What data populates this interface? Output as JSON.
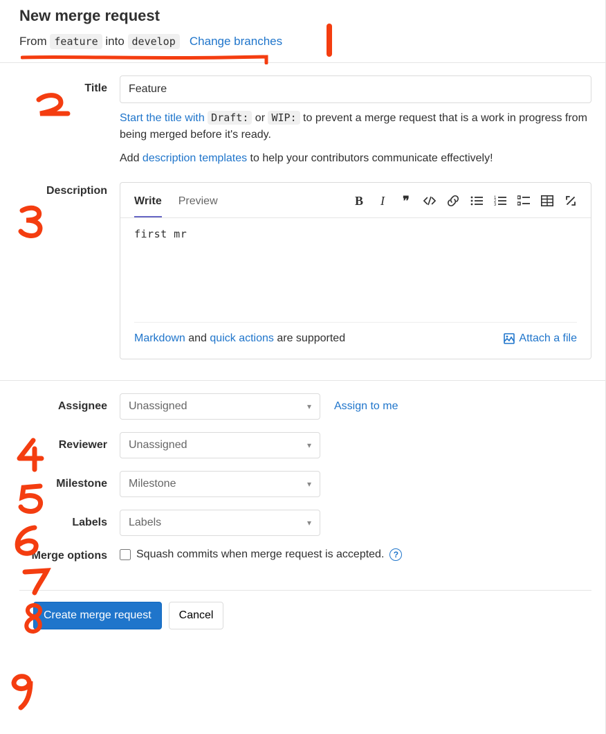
{
  "header": {
    "title": "New merge request",
    "from_label": "From",
    "source_branch": "feature",
    "into_label": "into",
    "target_branch": "develop",
    "change_branches_link": "Change branches"
  },
  "title_section": {
    "label": "Title",
    "value": "Feature",
    "helper_prefix": "Start the title with ",
    "draft_code": "Draft:",
    "or_text": " or ",
    "wip_code": "WIP:",
    "helper_suffix": " to prevent a merge request that is a work in progress from being merged before it's ready.",
    "templates_prefix": "Add ",
    "templates_link": "description templates",
    "templates_suffix": " to help your contributors communicate effectively!"
  },
  "description_section": {
    "label": "Description",
    "tab_write": "Write",
    "tab_preview": "Preview",
    "body": "first mr",
    "markdown_link": "Markdown",
    "and_text": " and ",
    "quick_actions_link": "quick actions",
    "supported_text": " are supported",
    "attach_label": "Attach a file"
  },
  "assignee": {
    "label": "Assignee",
    "value": "Unassigned",
    "assign_to_me": "Assign to me"
  },
  "reviewer": {
    "label": "Reviewer",
    "value": "Unassigned"
  },
  "milestone": {
    "label": "Milestone",
    "value": "Milestone"
  },
  "labels": {
    "label": "Labels",
    "value": "Labels"
  },
  "merge_options": {
    "label": "Merge options",
    "squash_label": "Squash commits when merge request is accepted."
  },
  "actions": {
    "submit": "Create merge request",
    "cancel": "Cancel"
  },
  "annotations": {
    "n1": "1",
    "n2": "2",
    "n3": "3",
    "n4": "4",
    "n5": "5",
    "n6": "6",
    "n7": "7",
    "n8": "8",
    "n9": "9"
  }
}
